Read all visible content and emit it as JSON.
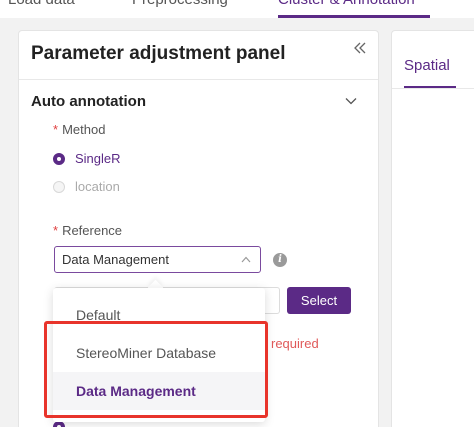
{
  "top_tabs": [
    {
      "label": "Load data"
    },
    {
      "label": "Preprocessing"
    },
    {
      "label": "Cluster & Annotation"
    }
  ],
  "panel": {
    "title": "Parameter adjustment panel",
    "collapse_icon": "double-chevron-left-icon"
  },
  "auto_annotation": {
    "title": "Auto annotation",
    "method": {
      "required_mark": "*",
      "label": "Method",
      "options": [
        "SingleR",
        "location"
      ],
      "selected": "SingleR"
    },
    "reference": {
      "required_mark": "*",
      "label": "Reference",
      "value": "Data Management",
      "options": [
        "Default",
        "StereoMiner Database",
        "Data Management"
      ]
    },
    "select_button": "Select",
    "error_text": "is required"
  },
  "right_panel": {
    "tab_label": "Spatial"
  },
  "colors": {
    "accent": "#5b2a86",
    "error": "#e05a5a",
    "highlight": "#e8342b"
  }
}
